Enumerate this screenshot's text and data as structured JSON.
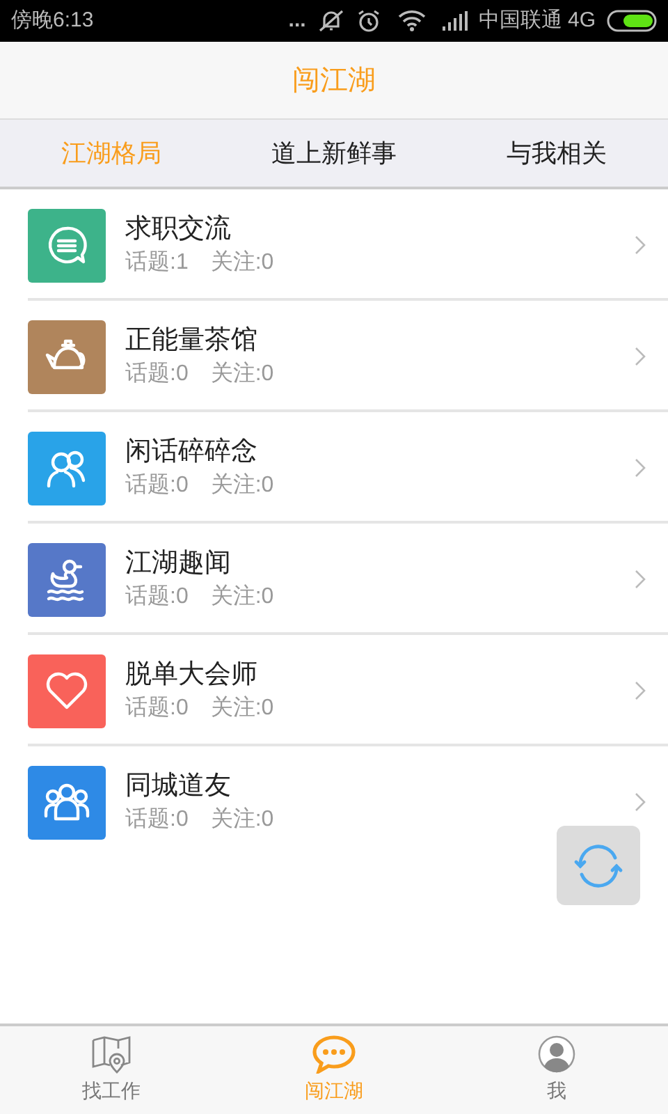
{
  "status_bar": {
    "time": "傍晚6:13",
    "dots": "...",
    "carrier": "中国联通 4G"
  },
  "header": {
    "title": "闯江湖"
  },
  "tabs": [
    {
      "label": "江湖格局",
      "selected": true
    },
    {
      "label": "道上新鲜事",
      "selected": false
    },
    {
      "label": "与我相关",
      "selected": false
    }
  ],
  "forums": [
    {
      "name": "求职交流",
      "topics": "话题:1",
      "follows": "关注:0",
      "kind": "chat",
      "color": "#3db38a"
    },
    {
      "name": "正能量茶馆",
      "topics": "话题:0",
      "follows": "关注:0",
      "kind": "kettle",
      "color": "#b0855c"
    },
    {
      "name": "闲话碎碎念",
      "topics": "话题:0",
      "follows": "关注:0",
      "kind": "people",
      "color": "#29a3e8"
    },
    {
      "name": "江湖趣闻",
      "topics": "话题:0",
      "follows": "关注:0",
      "kind": "duck",
      "color": "#5678c8"
    },
    {
      "name": "脱单大会师",
      "topics": "话题:0",
      "follows": "关注:0",
      "kind": "heart",
      "color": "#f9625a"
    },
    {
      "name": "同城道友",
      "topics": "话题:0",
      "follows": "关注:0",
      "kind": "group",
      "color": "#2e8ae6"
    }
  ],
  "bottom_nav": [
    {
      "label": "找工作",
      "kind": "map",
      "selected": false
    },
    {
      "label": "闯江湖",
      "kind": "chat",
      "selected": true
    },
    {
      "label": "我",
      "kind": "user",
      "selected": false
    }
  ]
}
